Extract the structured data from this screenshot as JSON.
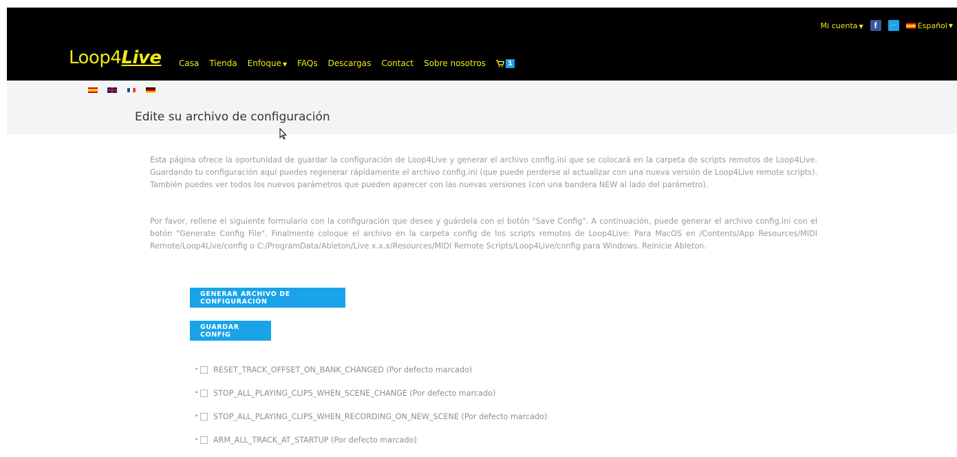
{
  "header": {
    "account_label": "Mi cuenta",
    "language_label": "Español",
    "logo_text_a": "Loop4",
    "logo_text_b": "Live",
    "nav": [
      "Casa",
      "Tienda",
      "Enfoque",
      "FAQs",
      "Descargas",
      "Contact",
      "Sobre nosotros"
    ],
    "cart_count": "1",
    "accent_color": "#f0e91a"
  },
  "flags": [
    "spain-flag-icon",
    "uk-flag-icon",
    "france-flag-icon",
    "germany-flag-icon"
  ],
  "page": {
    "title": "Edite su archivo de configuración",
    "paragraph1": "Esta página ofrece la oportunidad de guardar la configuración de Loop4Live y generar el archivo config.ini que se colocará en la carpeta de scripts remotos de Loop4Live. Guardando tu configuración aquí puedes regenerar rápidamente el archivo config.ini (que puede perderse al actualizar con una nueva versión de Loop4Live remote scripts). También puedes ver todos los nuevos parámetros que pueden aparecer con las nuevas versiones (con una bandera NEW al lado del parámetro).",
    "paragraph2": "Por favor, rellene el siguiente formulario con la configuración que desee y guárdela con el botón \"Save Config\". A continuación, puede generar el archivo config.ini con el botón \"Generate Config File\". Finalmente coloque el archivo en la carpeta config de los scripts remotos de Loop4Live: Para MacOS en /Contents/App Resources/MIDI Remote/Loop4Live/config o C:/ProgramData/Ableton/Live x.x.x/Resources/MIDI Remote Scripts/Loop4Live/config para Windows. Reinicie Ableton.",
    "generate_button": "GENERAR ARCHIVO DE CONFIGURACIÓN",
    "save_button": "GUARDAR CONFIG",
    "options": [
      "RESET_TRACK_OFFSET_ON_BANK_CHANGED (Por defecto marcado)",
      "STOP_ALL_PLAYING_CLIPS_WHEN_SCENE_CHANGE (Por defecto marcado)",
      "STOP_ALL_PLAYING_CLIPS_WHEN_RECORDING_ON_NEW_SCENE (Por defecto marcado)",
      "ARM_ALL_TRACK_AT_STARTUP (Por defecto marcado)"
    ],
    "button_color": "#1aa3e8"
  }
}
